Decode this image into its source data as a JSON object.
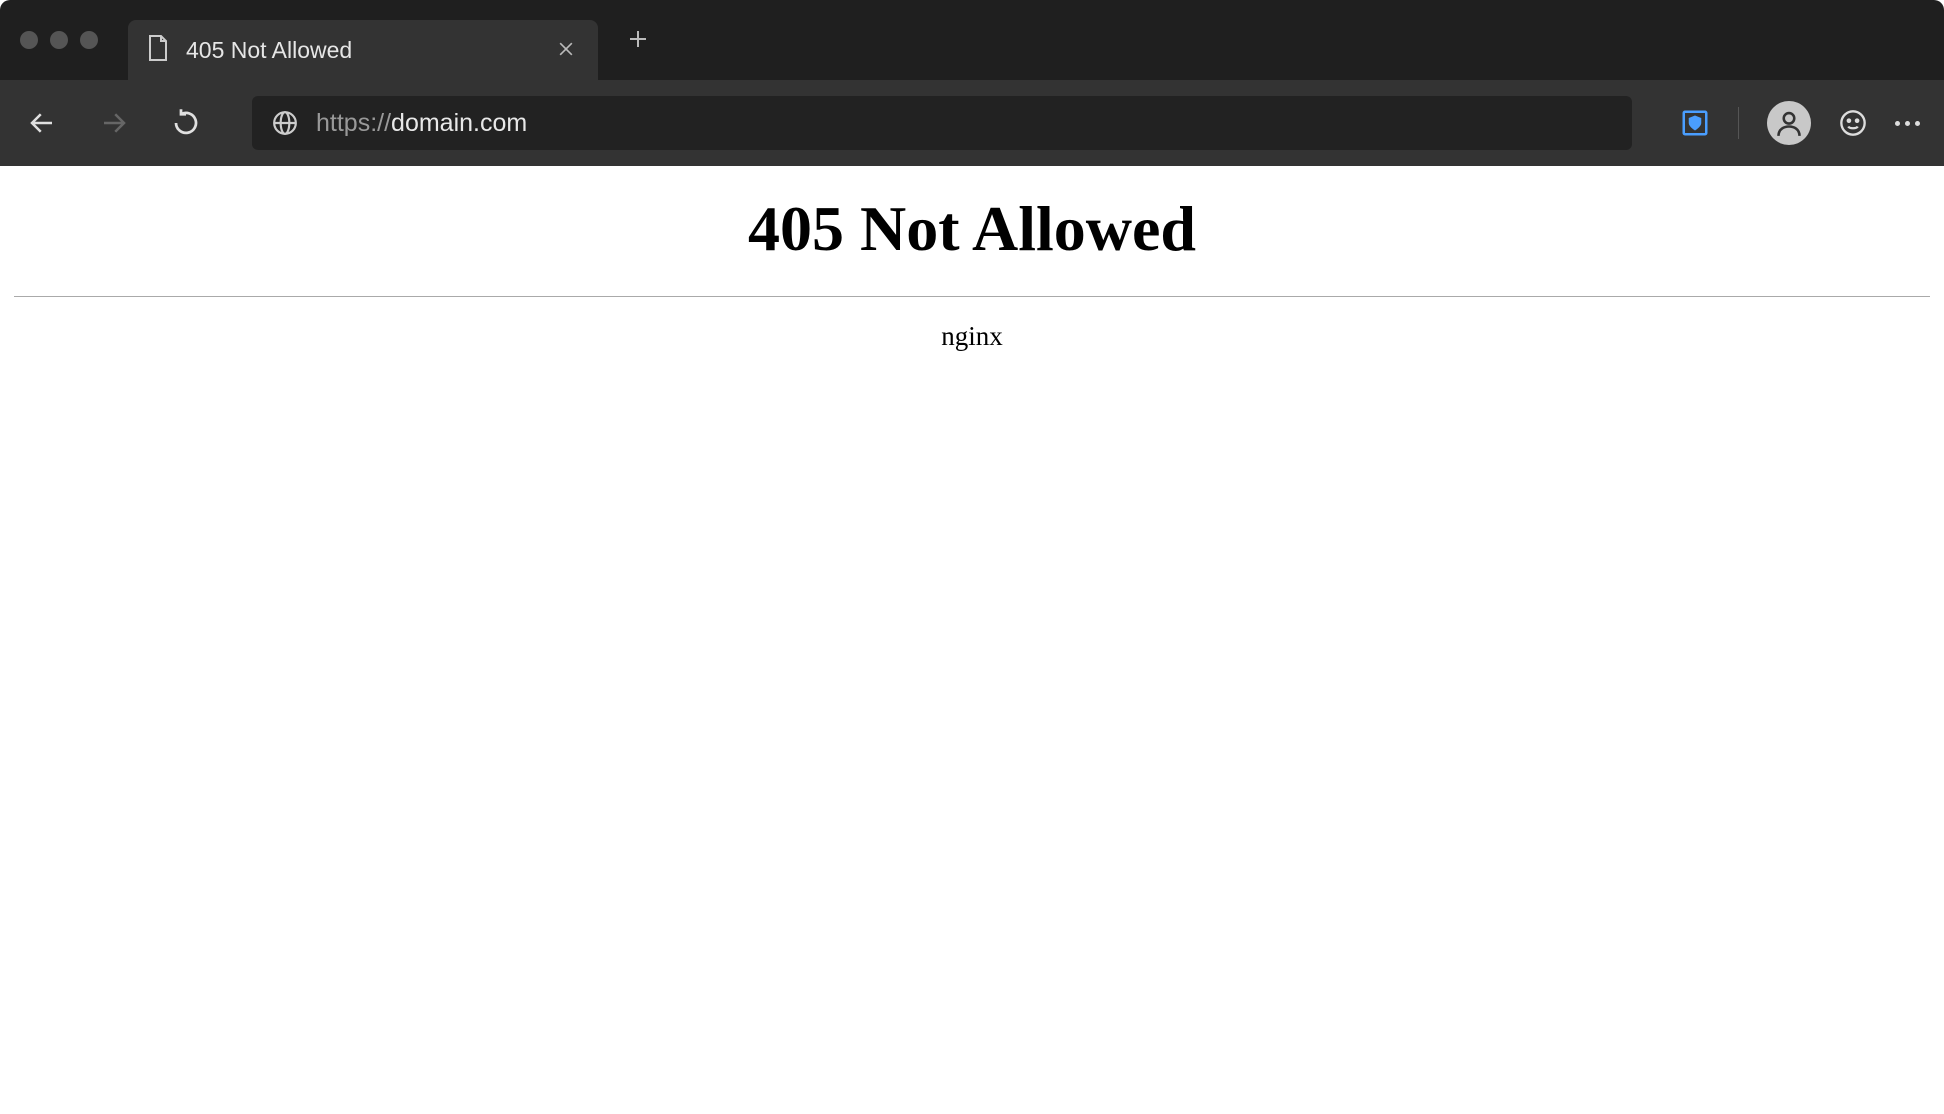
{
  "browser": {
    "tab": {
      "title": "405 Not Allowed"
    },
    "url_protocol": "https://",
    "url_domain": "domain.com",
    "url_full": "https://domain.com"
  },
  "page": {
    "error_heading": "405 Not Allowed",
    "server": "nginx"
  }
}
